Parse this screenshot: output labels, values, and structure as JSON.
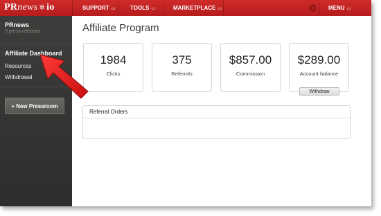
{
  "brand": {
    "logo_pr": "PR",
    "logo_news": "news",
    "logo_star": "✲",
    "logo_io": "io",
    "accent": "#c42323"
  },
  "topnav": {
    "items": [
      {
        "label": "SUPPORT",
        "arrow": "▭"
      },
      {
        "label": "TOOLS",
        "arrow": "▭"
      },
      {
        "label": "MARKETPLACE",
        "arrow": "▭"
      }
    ],
    "menu_label": "MENU",
    "menu_arrow": "▭",
    "settings_icon": "gear-icon"
  },
  "sidebar": {
    "account_name": "PRnews",
    "account_sub": "0 press releases",
    "items": [
      {
        "label": "Affiliate Dashboard"
      },
      {
        "label": "Resources"
      },
      {
        "label": "Withdrawal"
      }
    ],
    "new_button_label": "+ New Pressroom"
  },
  "main": {
    "title": "Affiliate Program",
    "cards": [
      {
        "value": "1984",
        "label": "Clicks"
      },
      {
        "value": "375",
        "label": "Referrals"
      },
      {
        "value": "$857.00",
        "label": "Commission"
      },
      {
        "value": "$289.00",
        "label": "Account balance"
      }
    ],
    "withdraw_label": "Withdraw",
    "referral_panel_title": "Referral Orders"
  }
}
